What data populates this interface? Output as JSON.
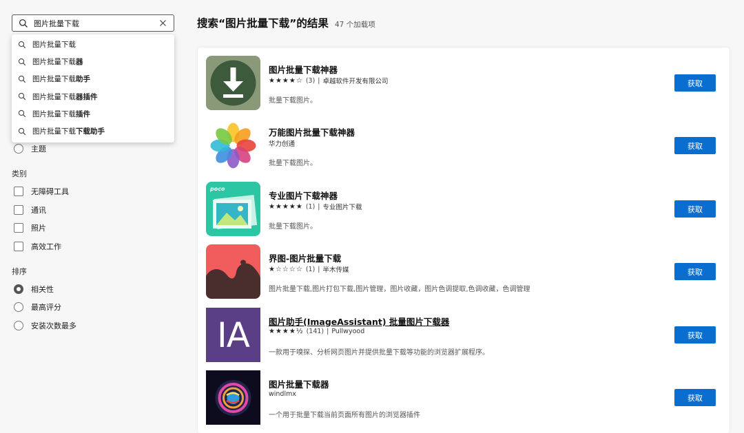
{
  "search": {
    "value": "图片批量下载",
    "suggestions": [
      {
        "plain": "图片批量下载",
        "bold": ""
      },
      {
        "plain": "图片批量下载",
        "bold": "器"
      },
      {
        "plain": "图片批量下载",
        "bold": "助手"
      },
      {
        "plain": "图片批量下载",
        "bold": "器插件"
      },
      {
        "plain": "图片批量下载",
        "bold": "插件"
      },
      {
        "plain": "图片批量下载",
        "bold": "下载助手"
      }
    ]
  },
  "filters": {
    "theme_label": "主题",
    "category_heading": "类别",
    "categories": [
      "无障碍工具",
      "通讯",
      "照片",
      "高效工作"
    ],
    "sort_heading": "排序",
    "sort_options": [
      "相关性",
      "最高评分",
      "安装次数最多"
    ],
    "sort_selected": "相关性"
  },
  "header": {
    "title": "搜索“图片批量下载”的结果",
    "count": "47 个加载项"
  },
  "results": [
    {
      "name": "图片批量下载神器",
      "stars": "★★★★☆",
      "rating_count": "(3)",
      "publisher": "卓越软件开发有限公司",
      "desc": "批量下载图片。",
      "button": "获取",
      "icon": "download-arrow-icon"
    },
    {
      "name": "万能图片批量下载神器",
      "stars": "",
      "rating_count": "",
      "publisher": "华力创通",
      "desc": "批量下载图片。",
      "button": "获取",
      "icon": "photos-flower-icon"
    },
    {
      "name": "专业图片下载神器",
      "stars": "★★★★★",
      "rating_count": "(1)",
      "publisher": "专业图片下载",
      "desc": "批量下载图片。",
      "button": "获取",
      "icon": "poco-gallery-icon"
    },
    {
      "name": "界图-图片批量下载",
      "stars": "★☆☆☆☆",
      "rating_count": "(1)",
      "publisher": "半木传媒",
      "desc": "图片批量下载,图片打包下载,图片管理，图片收藏，图片色调提取,色调收藏，色调管理",
      "button": "获取",
      "icon": "jietu-shape-icon"
    },
    {
      "name": "图片助手(ImageAssistant) 批量图片下载器",
      "stars": "★★★★½",
      "rating_count": "(141)",
      "publisher": "Pullwyood",
      "desc": "一款用于嗅探、分析网页图片并提供批量下载等功能的浏览器扩展程序。",
      "button": "获取",
      "icon": "ia-letters-icon",
      "icon_text": "IA"
    },
    {
      "name": "图片批量下载器",
      "stars": "",
      "rating_count": "",
      "publisher": "windlmx",
      "desc": "一个用于批量下载当前页面所有图片的浏览器插件",
      "button": "获取",
      "icon": "glowing-orb-icon"
    }
  ],
  "colors": {
    "accent": "#0a6ed1",
    "ia_purple": "#5a3f86",
    "download_green": "#5d7755"
  }
}
